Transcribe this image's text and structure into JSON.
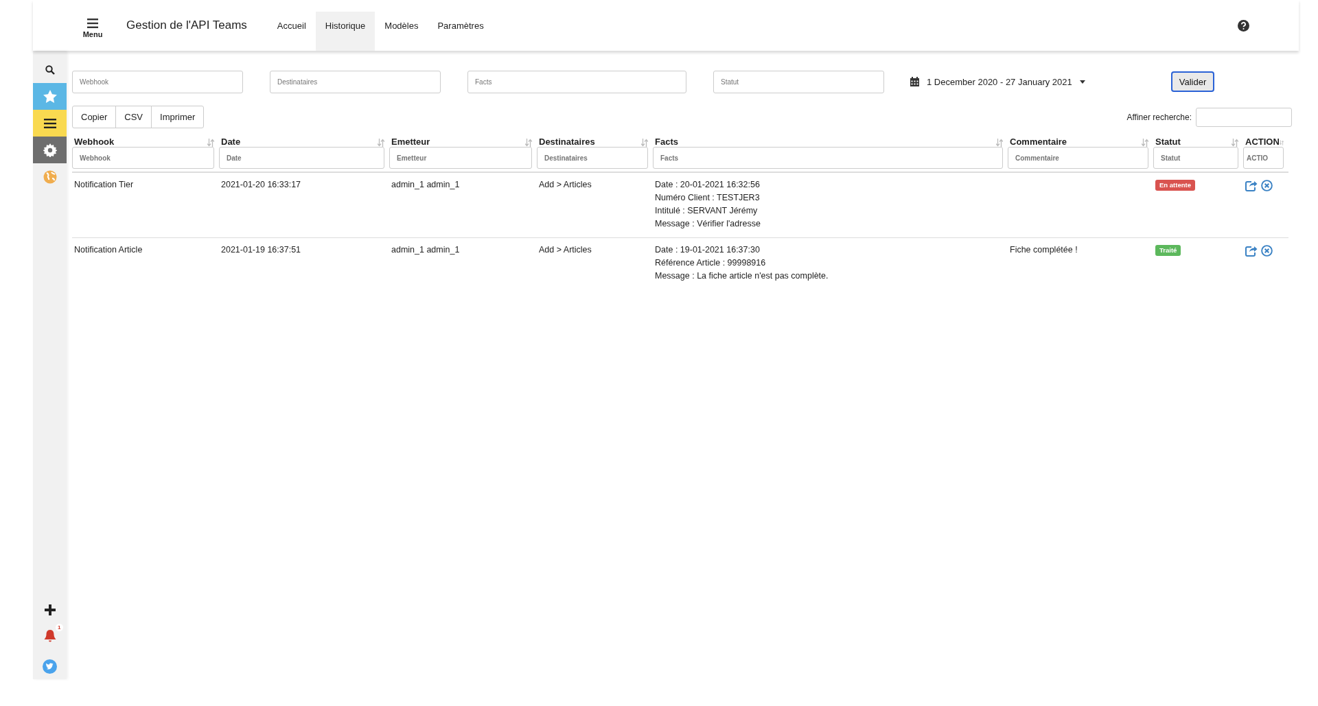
{
  "header": {
    "menu_label": "Menu",
    "title": "Gestion de l'API Teams",
    "tabs": [
      {
        "label": "Accueil",
        "selected": false
      },
      {
        "label": "Historique",
        "selected": true
      },
      {
        "label": "Modèles",
        "selected": false
      },
      {
        "label": "Paramètres",
        "selected": false
      }
    ]
  },
  "sidebar": {
    "items": [
      {
        "kind": "search"
      },
      {
        "kind": "star",
        "color": "#5bb7e5"
      },
      {
        "kind": "list",
        "color": "#f9d950"
      },
      {
        "kind": "gear",
        "color": "#6e6e6e"
      },
      {
        "kind": "globe"
      }
    ],
    "bottom": [
      {
        "kind": "plus"
      },
      {
        "kind": "bell",
        "badge": "1"
      },
      {
        "kind": "bird"
      }
    ]
  },
  "filters": {
    "fields": [
      {
        "placeholder": "Webhook"
      },
      {
        "placeholder": "Destinataires"
      },
      {
        "placeholder": "Facts"
      },
      {
        "placeholder": "Statut"
      }
    ],
    "date_range": "1 December 2020 - 27 January 2021",
    "submit": "Valider"
  },
  "export_buttons": [
    "Copier",
    "CSV",
    "Imprimer"
  ],
  "search": {
    "label": "Affiner recherche:"
  },
  "table": {
    "columns": [
      {
        "label": "Webhook",
        "placeholder": "Webhook"
      },
      {
        "label": "Date",
        "placeholder": "Date"
      },
      {
        "label": "Emetteur",
        "placeholder": "Emetteur"
      },
      {
        "label": "Destinataires",
        "placeholder": "Destinataires"
      },
      {
        "label": "Facts",
        "placeholder": "Facts"
      },
      {
        "label": "Commentaire",
        "placeholder": "Commentaire"
      },
      {
        "label": "Statut",
        "placeholder": "Statut"
      },
      {
        "label": "ACTION",
        "placeholder": "ACTIO"
      }
    ],
    "rows": [
      {
        "webhook": "Notification Tier",
        "date": "2021-01-20 16:33:17",
        "sender": "admin_1 admin_1",
        "recipients": "Add > Articles",
        "facts": [
          "Date : 20-01-2021 16:32:56",
          "Numéro Client : TESTJER3",
          "Intitulé : SERVANT Jérémy",
          "Message : Vérifier l'adresse"
        ],
        "comment": "",
        "status": {
          "label": "En attente",
          "kind": "pending"
        }
      },
      {
        "webhook": "Notification Article",
        "date": "2021-01-19 16:37:51",
        "sender": "admin_1 admin_1",
        "recipients": "Add > Articles",
        "facts": [
          "Date : 19-01-2021 16:37:30",
          "Référence Article : 99998916",
          "Message : La fiche article n'est pas complète."
        ],
        "comment": "Fiche complétée !",
        "status": {
          "label": "Traité",
          "kind": "done"
        }
      }
    ]
  }
}
